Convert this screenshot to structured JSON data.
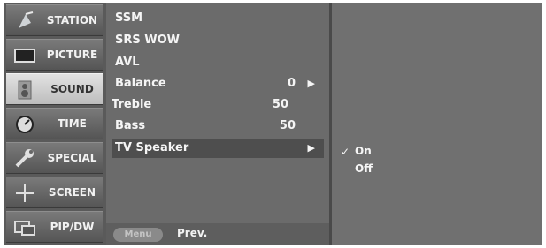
{
  "tabs": [
    {
      "label": "STATION",
      "icon": "satellite-dish-icon",
      "active": false
    },
    {
      "label": "PICTURE",
      "icon": "tv-screen-icon",
      "active": false
    },
    {
      "label": "SOUND",
      "icon": "speaker-icon",
      "active": true
    },
    {
      "label": "TIME",
      "icon": "clock-icon",
      "active": false
    },
    {
      "label": "SPECIAL",
      "icon": "wrench-icon",
      "active": false
    },
    {
      "label": "SCREEN",
      "icon": "move-cross-icon",
      "active": false
    },
    {
      "label": "PIP/DW",
      "icon": "pip-windows-icon",
      "active": false
    }
  ],
  "menu": {
    "items": [
      {
        "label": "SSM",
        "value": "",
        "arrow": ""
      },
      {
        "label": "SRS WOW",
        "value": "",
        "arrow": ""
      },
      {
        "label": "AVL",
        "value": "",
        "arrow": ""
      },
      {
        "label": "Balance",
        "value": "0",
        "arrow": "▶"
      },
      {
        "label": "Treble",
        "value": "50",
        "arrow": ""
      },
      {
        "label": "Bass",
        "value": "50",
        "arrow": ""
      },
      {
        "label": "TV Speaker",
        "value": "",
        "arrow": "▶"
      }
    ],
    "footer": {
      "menu_button": "Menu",
      "prev_label": "Prev."
    }
  },
  "submenu": {
    "options": [
      {
        "label": "On",
        "checked": true
      },
      {
        "label": "Off",
        "checked": false
      }
    ],
    "check_glyph": "✓"
  },
  "colors": {
    "active_tab": "#cfcfcf",
    "panel": "#6b6b6b",
    "highlight": "#4e4e4e"
  }
}
